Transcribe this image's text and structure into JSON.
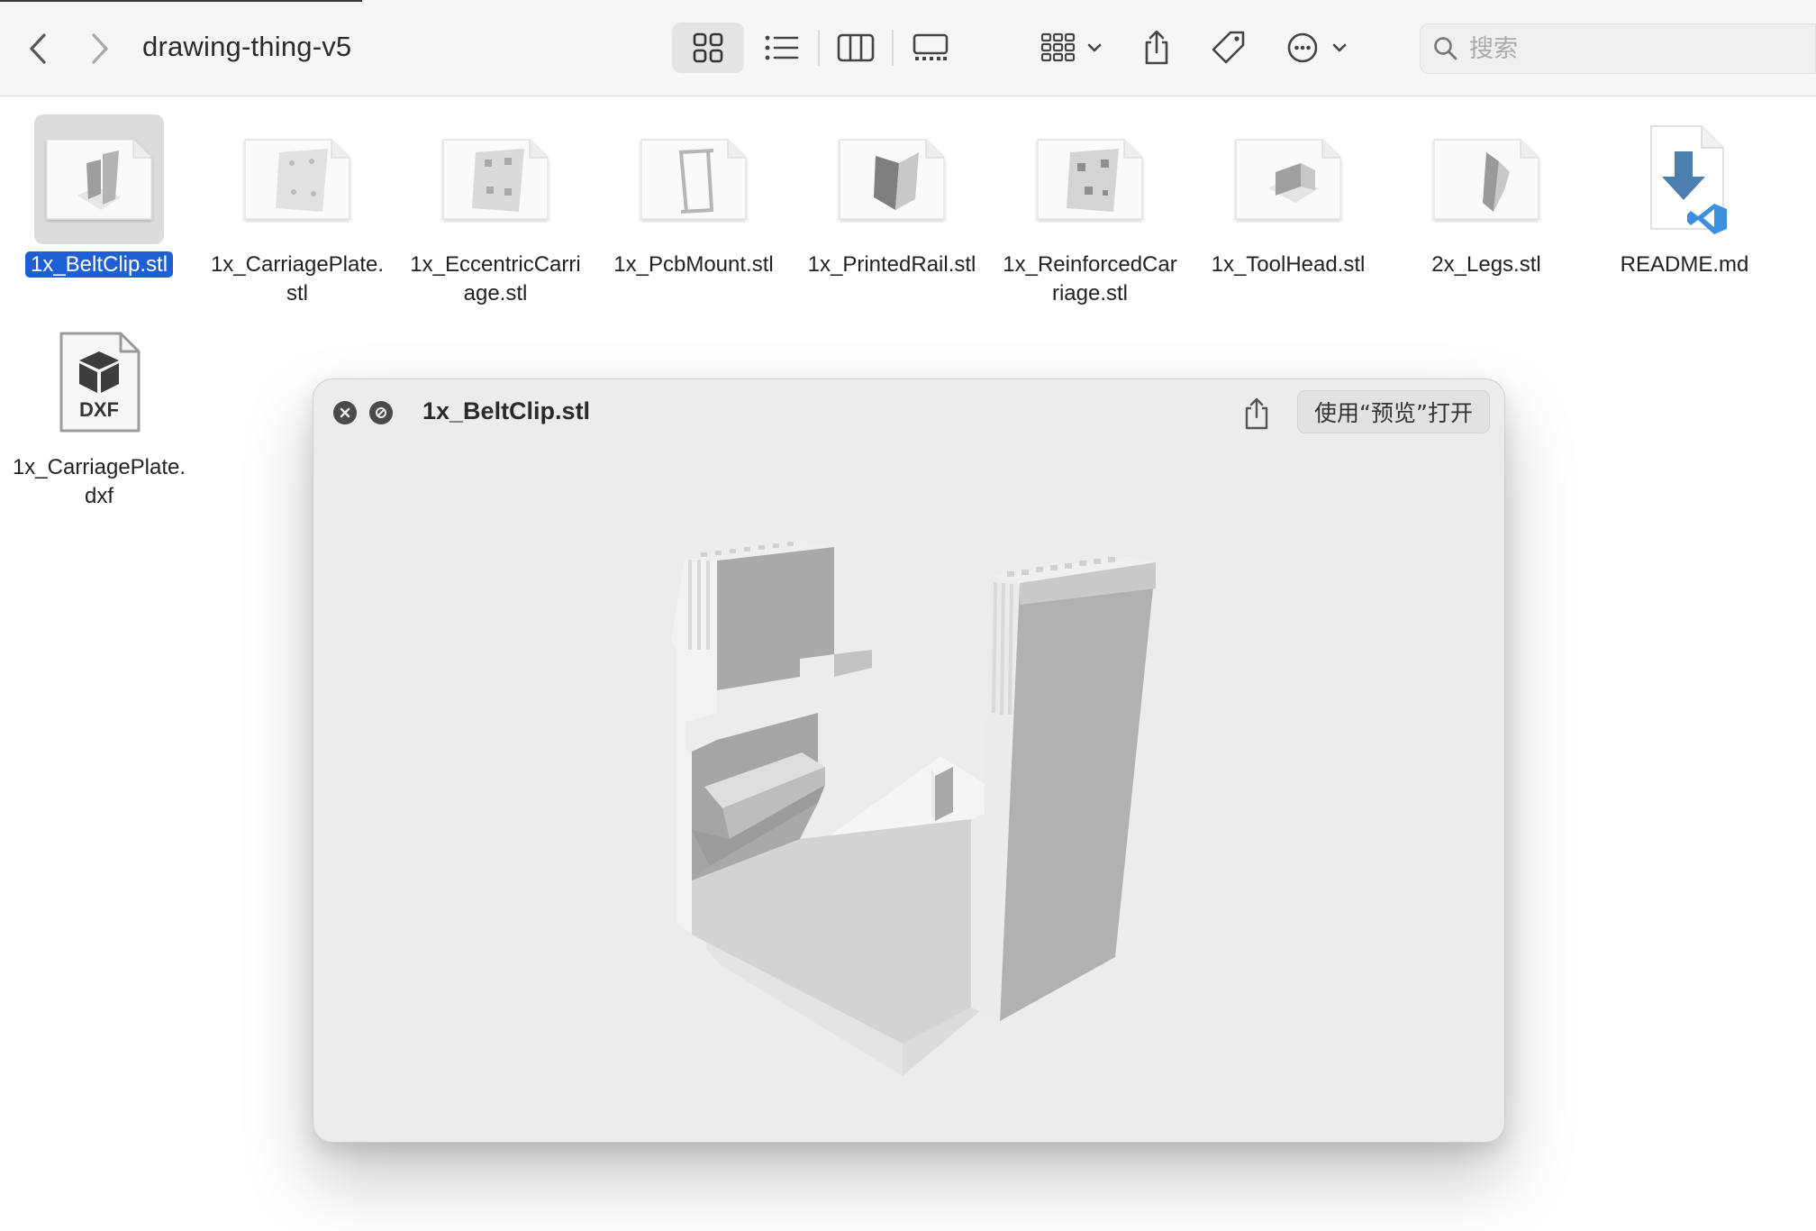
{
  "toolbar": {
    "back_icon": "chevron-left-icon",
    "forward_icon": "chevron-right-icon",
    "folder_title": "drawing-thing-v5",
    "views": [
      "icon-view",
      "list-view",
      "column-view",
      "gallery-view"
    ],
    "selected_view": "icon-view",
    "group_icon": "group-by-icon",
    "share_icon": "share-icon",
    "tag_icon": "tag-icon",
    "more_icon": "more-options-icon",
    "search": {
      "placeholder": "搜索",
      "value": ""
    }
  },
  "files": [
    {
      "name": "1x_BeltClip.stl",
      "kind": "stl",
      "selected": true
    },
    {
      "name": "1x_CarriagePlate.\nstl",
      "kind": "stl",
      "selected": false
    },
    {
      "name": "1x_EccentricCarri\nage.stl",
      "kind": "stl",
      "selected": false
    },
    {
      "name": "1x_PcbMount.stl",
      "kind": "stl",
      "selected": false
    },
    {
      "name": "1x_PrintedRail.stl",
      "kind": "stl",
      "selected": false
    },
    {
      "name": "1x_ReinforcedCar\nriage.stl",
      "kind": "stl",
      "selected": false
    },
    {
      "name": "1x_ToolHead.stl",
      "kind": "stl",
      "selected": false
    },
    {
      "name": "2x_Legs.stl",
      "kind": "stl",
      "selected": false
    },
    {
      "name": "README.md",
      "kind": "md",
      "selected": false
    },
    {
      "name": "1x_CarriagePlate.\ndxf",
      "kind": "dxf",
      "selected": false,
      "badge": "DXF"
    }
  ],
  "quicklook": {
    "title": "1x_BeltClip.stl",
    "open_with_label": "使用“预览”打开",
    "close_icon": "close-icon",
    "disable_icon": "slash-circle-icon",
    "share_icon": "share-icon",
    "preview": "3d-model-preview"
  },
  "colors": {
    "selection": "#1f5fd6",
    "vscode_blue": "#3c8fdc",
    "download_blue": "#4a7fae"
  }
}
